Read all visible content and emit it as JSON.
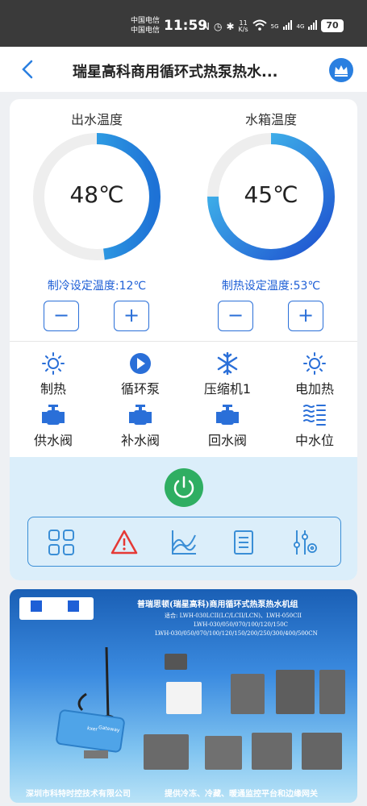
{
  "status_bar": {
    "carrier_1": "中国电信",
    "carrier_2": "中国电信",
    "time": "11:59",
    "net_speed_value": "11",
    "net_speed_unit": "K/s",
    "signal_1": "5G",
    "signal_2": "4G",
    "battery": "70"
  },
  "header": {
    "title": "瑞星高科商用循环式热泵热水..."
  },
  "gauges": [
    {
      "title": "出水温度",
      "value": "48℃",
      "fill_fraction": 0.48,
      "color_start": "#3ec4ef",
      "color_end": "#1e72d6"
    },
    {
      "title": "水箱温度",
      "value": "45℃",
      "fill_fraction": 0.75,
      "color_start": "#1d4fcf",
      "color_end": "#47c9f0"
    }
  ],
  "setpoints": {
    "cooling": "制冷设定温度:12℃",
    "heating": "制热设定温度:53℃",
    "minus": "−",
    "plus": "+"
  },
  "status_items": [
    {
      "label": "制热",
      "icon": "sun-icon"
    },
    {
      "label": "循环泵",
      "icon": "pump-icon"
    },
    {
      "label": "压缩机1",
      "icon": "snowflake-icon"
    },
    {
      "label": "电加热",
      "icon": "heater-icon"
    },
    {
      "label": "供水阀",
      "icon": "valve-icon"
    },
    {
      "label": "补水阀",
      "icon": "valve-icon"
    },
    {
      "label": "回水阀",
      "icon": "valve-icon"
    },
    {
      "label": "中水位",
      "icon": "water-level-icon"
    }
  ],
  "toolbar": {
    "icons": [
      "grid-icon",
      "alarm-icon",
      "chart-icon",
      "list-icon",
      "settings-icon"
    ]
  },
  "colors": {
    "accent": "#1e5fd6",
    "power": "#2fae62",
    "alarm": "#e53935"
  },
  "banner": {
    "title": "普瑞思顿(瑞星高科)商用循环式热泵热水机组",
    "line_1": "适合: LWH-030LCII(LC/LCII/LCN)、LWH-050CII",
    "line_2": "LWH-030/050/070/100/120/150C",
    "line_3": "LWH-030/050/070/100/120/150/200/250/300/400/500CN",
    "footer_left": "深圳市科特时控技术有限公司",
    "footer_right": "提供冷冻、冷藏、暖通监控平台和边缘网关",
    "device_label_1": "kxer",
    "device_label_2": "Gateway"
  }
}
